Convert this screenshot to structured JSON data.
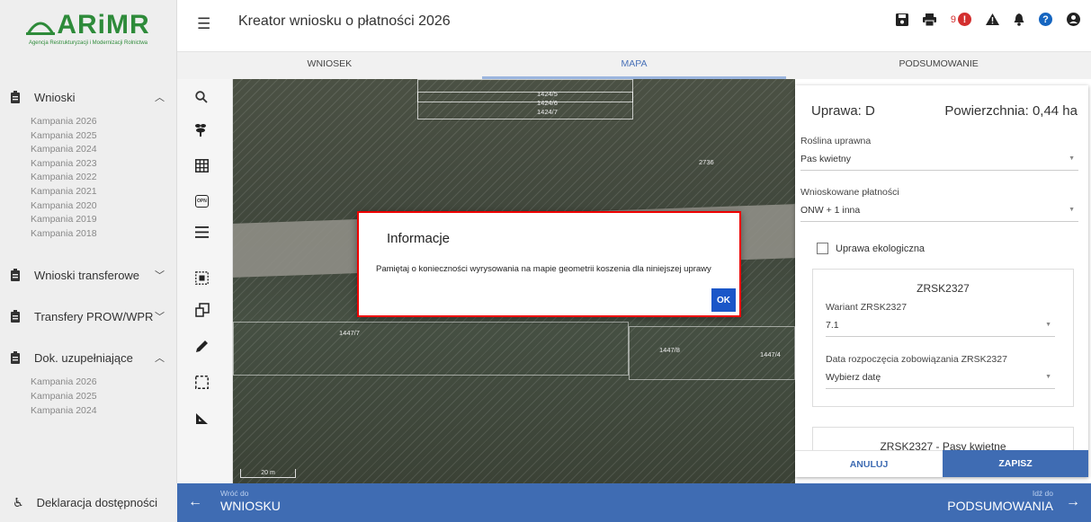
{
  "brand": {
    "logo_text": "ARiMR",
    "logo_subtitle": "Agencja Restrukturyzacji i Modernizacji Rolnictwa",
    "color": "#2e8b3a"
  },
  "header": {
    "title": "Kreator wniosku o płatności 2026",
    "notification_count": "9",
    "alert_badge": "!",
    "help_badge": "?",
    "icons": [
      "save-icon",
      "print-icon",
      "alert-circle-icon",
      "warning-icon",
      "bell-icon",
      "help-icon",
      "user-icon"
    ]
  },
  "tabs": [
    {
      "label": "WNIOSEK",
      "active": false
    },
    {
      "label": "MAPA",
      "active": true
    },
    {
      "label": "PODSUMOWANIE",
      "active": false
    }
  ],
  "sidebar": {
    "wnioski": {
      "label": "Wnioski",
      "items": [
        "Kampania 2026",
        "Kampania 2025",
        "Kampania 2024",
        "Kampania 2023",
        "Kampania 2022",
        "Kampania 2021",
        "Kampania 2020",
        "Kampania 2019",
        "Kampania 2018"
      ]
    },
    "transferowe": {
      "label": "Wnioski transferowe"
    },
    "transfery": {
      "label": "Transfery PROW/WPR"
    },
    "dok": {
      "label": "Dok. uzupełniające",
      "items": [
        "Kampania 2026",
        "Kampania 2025",
        "Kampania 2024"
      ]
    },
    "deklaracja": {
      "label": "Deklaracja dostępności"
    }
  },
  "tools": [
    "search-icon",
    "plant-icon",
    "grid-icon",
    "opn-icon",
    "list-icon",
    "select-square-icon",
    "copy-shape-icon",
    "pencil-icon",
    "dashed-rect-icon",
    "ruler-icon"
  ],
  "tool_opn_label": "OPN",
  "map": {
    "labels": [
      "1424/5",
      "1424/6",
      "1424/7",
      "2736",
      "1447/7",
      "1447/8",
      "1447/4",
      "20 m"
    ]
  },
  "panel": {
    "uprawa": "Uprawa: D",
    "powierzchnia": "Powierzchnia: 0,44 ha",
    "roslina_label": "Roślina uprawna",
    "roslina_value": "Pas kwietny",
    "platnosci_label": "Wnioskowane płatności",
    "platnosci_value": "ONW + 1 inna",
    "eko_label": "Uprawa ekologiczna",
    "card1_title": "ZRSK2327",
    "wariant_label": "Wariant ZRSK2327",
    "wariant_value": "7.1",
    "data_label": "Data rozpoczęcia zobowiązania ZRSK2327",
    "data_placeholder": "Wybierz datę",
    "card2_title": "ZRSK2327 - Pasy kwietne",
    "cancel": "ANULUJ",
    "save": "ZAPISZ"
  },
  "bottom": {
    "back_small": "Wróć do",
    "back_big": "WNIOSKU",
    "next_small": "Idź do",
    "next_big": "PODSUMOWANIA"
  },
  "modal": {
    "title": "Informacje",
    "text": "Pamiętaj o konieczności wyrysowania na mapie geometrii koszenia dla niniejszej uprawy",
    "ok": "OK"
  }
}
